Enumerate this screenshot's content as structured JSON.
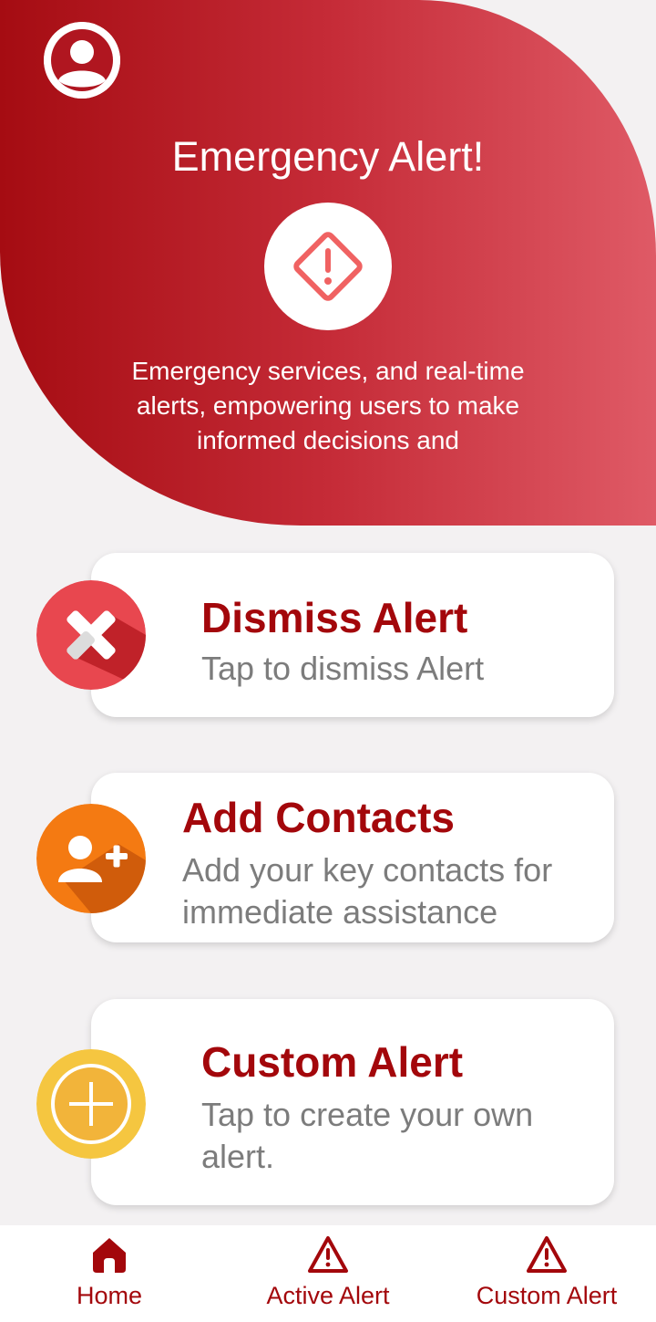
{
  "hero": {
    "title": "Emergency Alert!",
    "description": "Emergency services, and real-time alerts, empowering users to make informed decisions and"
  },
  "cards": [
    {
      "title": "Dismiss Alert",
      "subtitle": "Tap to dismiss Alert",
      "icon": "close-x-icon",
      "color": "#e8474f"
    },
    {
      "title": "Add Contacts",
      "subtitle": "Add your key contacts for immediate assistance",
      "icon": "add-user-icon",
      "color": "#f47a12"
    },
    {
      "title": "Custom Alert",
      "subtitle": "Tap to create your own alert.",
      "icon": "plus-circle-icon",
      "color": "#f5c640"
    }
  ],
  "nav": {
    "items": [
      {
        "label": "Home",
        "icon": "home-icon"
      },
      {
        "label": "Active Alert",
        "icon": "warning-triangle-icon"
      },
      {
        "label": "Custom Alert",
        "icon": "warning-triangle-icon"
      }
    ],
    "active_color": "#a3070b"
  },
  "colors": {
    "brand": "#a3070b",
    "hero_gradient_start": "#a50c12",
    "hero_gradient_end": "#df5a66",
    "background": "#f3f1f2"
  }
}
